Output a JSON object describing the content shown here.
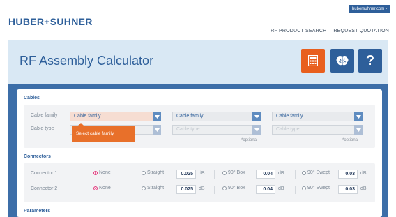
{
  "header": {
    "site_link": "hubersuhner.com",
    "site_link_chevron": "›",
    "logo": "HUBER+SUHNER",
    "nav": [
      "RF PRODUCT SEARCH",
      "REQUEST QUOTATION"
    ]
  },
  "banner": {
    "title": "RF Assembly Calculator",
    "tools": [
      {
        "icon": "calculator-icon",
        "color": "#e85f1e"
      },
      {
        "icon": "brain-icon",
        "color": "#2e5f9a"
      },
      {
        "icon": "help-icon",
        "label": "?",
        "color": "#2e5f9a"
      }
    ]
  },
  "cables": {
    "title": "Cables",
    "labels": {
      "family": "Cable family",
      "type": "Cable type"
    },
    "family_selects": [
      "Cable family",
      "Cable family",
      "Cable family"
    ],
    "type_selects": [
      "",
      "Cable type",
      "Cable type"
    ],
    "optional": [
      "*optional",
      "*optional"
    ],
    "tooltip": "Select cable family"
  },
  "connectors": {
    "title": "Connectors",
    "rows": [
      {
        "label": "Connector 1",
        "options": [
          "None",
          "Straight",
          "90° Box",
          "90° Swept"
        ],
        "selected": "None",
        "values": [
          "0.025",
          "0.04",
          "0.03"
        ],
        "unit": "dB"
      },
      {
        "label": "Connector 2",
        "options": [
          "None",
          "Straight",
          "90° Box",
          "90° Swept"
        ],
        "selected": "None",
        "values": [
          "0.025",
          "0.04",
          "0.03"
        ],
        "unit": "dB"
      }
    ]
  },
  "parameters": {
    "title": "Parameters"
  },
  "colors": {
    "accent_orange": "#e85f1e",
    "brand_blue": "#2e5f9a",
    "radio_selected": "#e0367a"
  }
}
